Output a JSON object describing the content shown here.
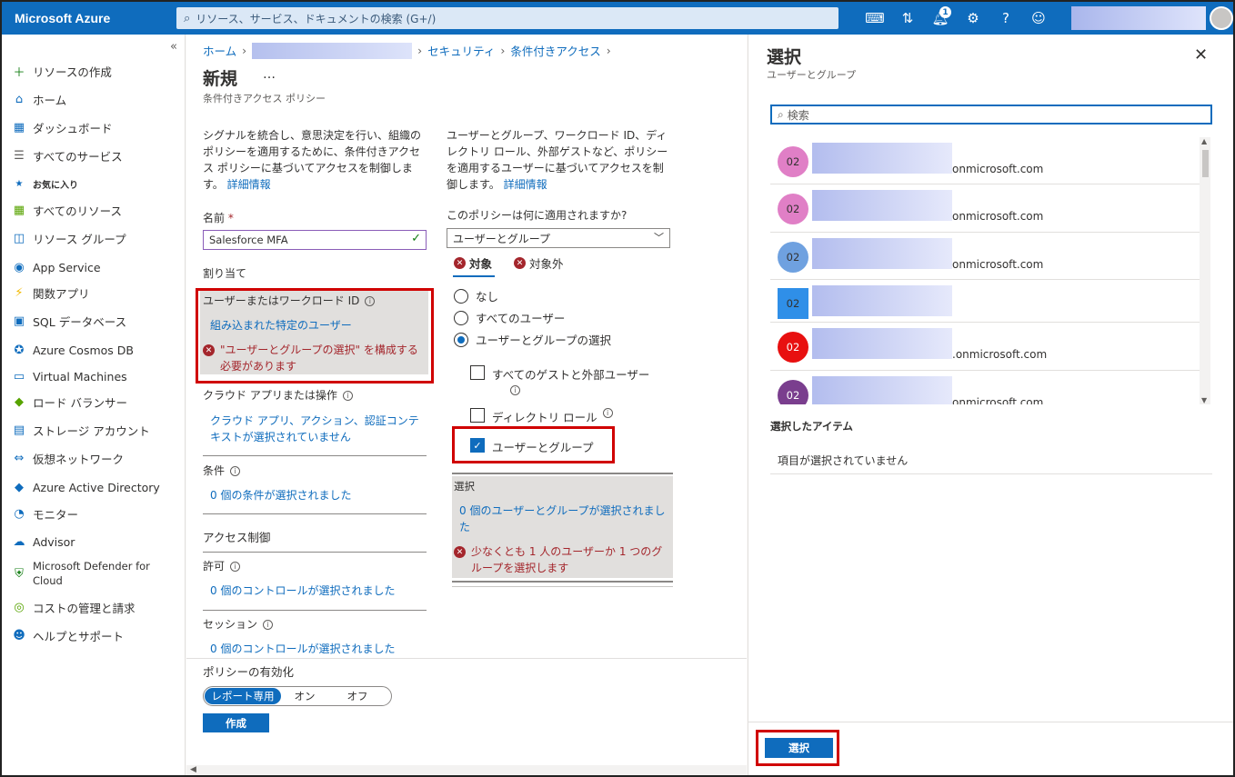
{
  "topbar": {
    "brand": "Microsoft Azure",
    "search_placeholder": "リソース、サービス、ドキュメントの検索 (G+/)",
    "notification_count": "1",
    "icons": [
      "cloud-shell-icon",
      "directory-filter-icon",
      "notifications-icon",
      "settings-icon",
      "help-icon",
      "feedback-icon"
    ]
  },
  "sidebar": {
    "collapse": "«",
    "items": [
      {
        "label": "リソースの作成",
        "icon": "plus-icon"
      },
      {
        "label": "ホーム",
        "icon": "home-icon"
      },
      {
        "label": "ダッシュボード",
        "icon": "dashboard-icon"
      },
      {
        "label": "すべてのサービス",
        "icon": "list-icon"
      },
      {
        "label": "お気に入り",
        "icon": "star-icon"
      },
      {
        "label": "すべてのリソース",
        "icon": "grid-icon"
      },
      {
        "label": "リソース グループ",
        "icon": "resource-group-icon"
      },
      {
        "label": "App Service",
        "icon": "app-service-icon"
      },
      {
        "label": "関数アプリ",
        "icon": "function-icon"
      },
      {
        "label": "SQL データベース",
        "icon": "sql-icon"
      },
      {
        "label": "Azure Cosmos DB",
        "icon": "cosmos-icon"
      },
      {
        "label": "Virtual Machines",
        "icon": "vm-icon"
      },
      {
        "label": "ロード バランサー",
        "icon": "load-balancer-icon"
      },
      {
        "label": "ストレージ アカウント",
        "icon": "storage-icon"
      },
      {
        "label": "仮想ネットワーク",
        "icon": "vnet-icon"
      },
      {
        "label": "Azure Active Directory",
        "icon": "aad-icon"
      },
      {
        "label": "モニター",
        "icon": "monitor-icon"
      },
      {
        "label": "Advisor",
        "icon": "advisor-icon"
      },
      {
        "label": "Microsoft Defender for Cloud",
        "icon": "shield-icon"
      },
      {
        "label": "コストの管理と請求",
        "icon": "cost-icon"
      },
      {
        "label": "ヘルプとサポート",
        "icon": "support-icon"
      }
    ]
  },
  "breadcrumb": {
    "home": "ホーム",
    "security": "セキュリティ",
    "ca": "条件付きアクセス"
  },
  "page": {
    "title": "新規",
    "more": "…",
    "subtitle": "条件付きアクセス ポリシー"
  },
  "left": {
    "intro": "シグナルを統合し、意思決定を行い、組織のポリシーを適用するために、条件付きアクセス ポリシーに基づいてアクセスを制御します。",
    "intro_link": "詳細情報",
    "name_label": "名前",
    "required": "*",
    "name_value": "Salesforce MFA",
    "assign": "割り当て",
    "users_label": "ユーザーまたはワークロード ID",
    "users_value": "組み込まれた特定のユーザー",
    "users_error": "\"ユーザーとグループの選択\" を構成する必要があります",
    "cloud_label": "クラウド アプリまたは操作",
    "cloud_value": "クラウド アプリ、アクション、認証コンテキストが選択されていません",
    "cond_label": "条件",
    "cond_value": "0 個の条件が選択されました",
    "access": "アクセス制御",
    "grant_label": "許可",
    "grant_value": "0 個のコントロールが選択されました",
    "session_label": "セッション",
    "session_value": "0 個のコントロールが選択されました"
  },
  "right_col": {
    "intro": "ユーザーとグループ、ワークロード ID、ディレクトリ ロール、外部ゲストなど、ポリシーを適用するユーザーに基づいてアクセスを制御します。",
    "intro_link": "詳細情報",
    "applies_label": "このポリシーは何に適用されますか?",
    "applies_value": "ユーザーとグループ",
    "tab_include": "対象",
    "tab_exclude": "対象外",
    "radio_none": "なし",
    "radio_all": "すべてのユーザー",
    "radio_select": "ユーザーとグループの選択",
    "cb_guests": "すべてのゲストと外部ユーザー",
    "cb_roles": "ディレクトリ ロール",
    "cb_users": "ユーザーとグループ",
    "select_label": "選択",
    "select_value": "0 個のユーザーとグループが選択されました",
    "select_error": "少なくとも 1 人のユーザーか 1 つのグループを選択します"
  },
  "footer": {
    "enable_label": "ポリシーの有効化",
    "toggle": [
      "レポート専用",
      "オン",
      "オフ"
    ],
    "create": "作成"
  },
  "panel": {
    "title": "選択",
    "subtitle": "ユーザーとグループ",
    "search_placeholder": "検索",
    "users": [
      {
        "initials": "02",
        "color": "#e07fc6",
        "domain": "onmicrosoft.com",
        "square": false
      },
      {
        "initials": "02",
        "color": "#e07fc6",
        "domain": "onmicrosoft.com",
        "square": false
      },
      {
        "initials": "02",
        "color": "#6fa1e0",
        "domain": "onmicrosoft.com",
        "square": false
      },
      {
        "initials": "02",
        "color": "#2f8fe8",
        "domain": "",
        "square": true
      },
      {
        "initials": "02",
        "color": "#e81010",
        "domain": ".onmicrosoft.com",
        "square": false
      },
      {
        "initials": "02",
        "color": "#7a3e8e",
        "domain": "onmicrosoft.com",
        "square": false
      }
    ],
    "selected_title": "選択したアイテム",
    "selected_empty": "項目が選択されていません",
    "select_button": "選択"
  }
}
